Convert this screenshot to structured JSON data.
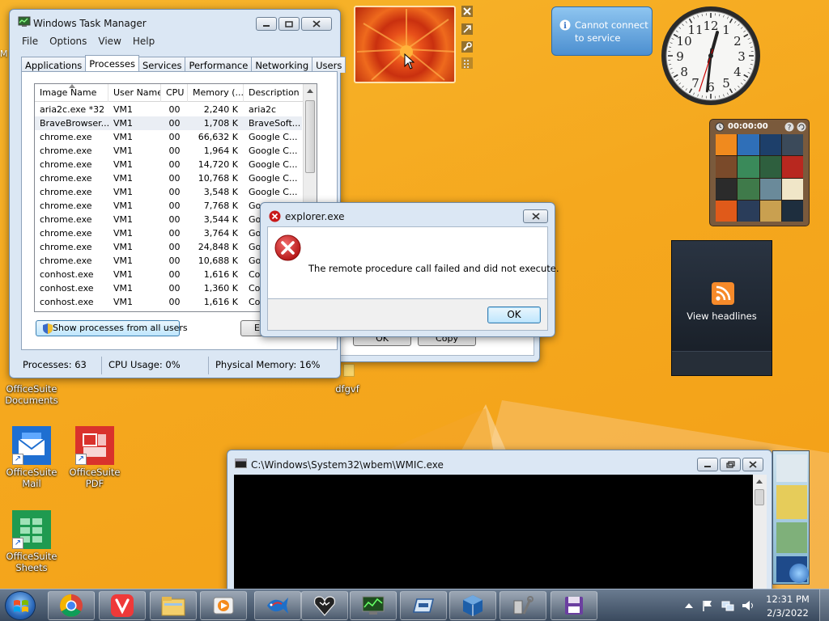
{
  "task_manager": {
    "title": "Windows Task Manager",
    "menu": [
      "File",
      "Options",
      "View",
      "Help"
    ],
    "tabs": [
      "Applications",
      "Processes",
      "Services",
      "Performance",
      "Networking",
      "Users"
    ],
    "active_tab": "Processes",
    "columns": [
      "Image Name",
      "User Name",
      "CPU",
      "Memory (...",
      "Description"
    ],
    "rows": [
      [
        "aria2c.exe *32",
        "VM1",
        "00",
        "2,240 K",
        "aria2c"
      ],
      [
        "BraveBrowser...",
        "VM1",
        "00",
        "1,708 K",
        "BraveSoft..."
      ],
      [
        "chrome.exe",
        "VM1",
        "00",
        "66,632 K",
        "Google C..."
      ],
      [
        "chrome.exe",
        "VM1",
        "00",
        "1,964 K",
        "Google C..."
      ],
      [
        "chrome.exe",
        "VM1",
        "00",
        "14,720 K",
        "Google C..."
      ],
      [
        "chrome.exe",
        "VM1",
        "00",
        "10,768 K",
        "Google C..."
      ],
      [
        "chrome.exe",
        "VM1",
        "00",
        "3,548 K",
        "Google C..."
      ],
      [
        "chrome.exe",
        "VM1",
        "00",
        "7,768 K",
        "Goo"
      ],
      [
        "chrome.exe",
        "VM1",
        "00",
        "3,544 K",
        "Goo"
      ],
      [
        "chrome.exe",
        "VM1",
        "00",
        "3,764 K",
        "Goo"
      ],
      [
        "chrome.exe",
        "VM1",
        "00",
        "24,848 K",
        "Goo"
      ],
      [
        "chrome.exe",
        "VM1",
        "00",
        "10,688 K",
        "Goo"
      ],
      [
        "conhost.exe",
        "VM1",
        "00",
        "1,616 K",
        "Con"
      ],
      [
        "conhost.exe",
        "VM1",
        "00",
        "1,360 K",
        "Con"
      ],
      [
        "conhost.exe",
        "VM1",
        "00",
        "1,616 K",
        "Con"
      ]
    ],
    "show_all_button": "Show processes from all users",
    "end_button": "Er",
    "status": {
      "processes": "Processes: 63",
      "cpu": "CPU Usage: 0%",
      "memory": "Physical Memory: 16%"
    }
  },
  "back_dialog": {
    "ok": "OK",
    "copy": "Copy"
  },
  "error_dialog": {
    "title": "explorer.exe",
    "message": "The remote procedure call failed and did not execute.",
    "ok": "OK"
  },
  "cmd_window": {
    "title": "C:\\Windows\\System32\\wbem\\WMIC.exe"
  },
  "gadgets": {
    "weather": {
      "line1": "Cannot connect",
      "line2": "to service"
    },
    "puzzle": {
      "timer": "00:00:00"
    },
    "feed": {
      "label": "View headlines"
    },
    "clock": {
      "numbers": [
        "12",
        "1",
        "2",
        "3",
        "4",
        "5",
        "6",
        "7",
        "8",
        "9",
        "10",
        "11"
      ]
    }
  },
  "desktop": {
    "icons": [
      {
        "label": "OfficeSuite Documents"
      },
      {
        "label": "OfficeSuite Mail"
      },
      {
        "label": "OfficeSuite PDF"
      },
      {
        "label": "OfficeSuite Sheets"
      },
      {
        "label": "dfgvf"
      }
    ],
    "cut_label": "M"
  },
  "taskbar": {
    "time": "12:31 PM",
    "date": "2/3/2022"
  },
  "colors": {
    "accent": "#3c7fb1",
    "error": "#c81a1a",
    "desktop": "#f5a81e"
  }
}
